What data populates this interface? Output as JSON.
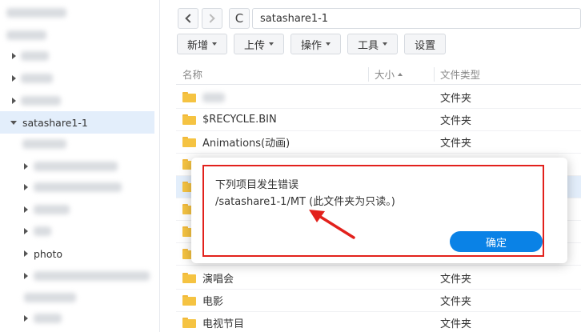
{
  "sidebar": {
    "selected_label": "satashare1-1",
    "child_label_photo": "photo"
  },
  "nav": {
    "refresh_glyph": "C",
    "path": "satashare1-1"
  },
  "toolbar": {
    "items": [
      {
        "label": "新增"
      },
      {
        "label": "上传"
      },
      {
        "label": "操作"
      },
      {
        "label": "工具"
      },
      {
        "label": "设置"
      }
    ]
  },
  "list": {
    "headers": {
      "name": "名称",
      "size": "大小",
      "type": "文件类型"
    },
    "rows": [
      {
        "name": "",
        "type": "文件夹"
      },
      {
        "name": "$RECYCLE.BIN",
        "type": "文件夹"
      },
      {
        "name": "Animations(动画)",
        "type": "文件夹"
      },
      {
        "name": "演唱会",
        "type": "文件夹"
      },
      {
        "name": "电影",
        "type": "文件夹"
      },
      {
        "name": "电视节目",
        "type": "文件夹"
      }
    ]
  },
  "dialog": {
    "title": "下列项目发生错误",
    "message": "/satashare1-1/MT (此文件夹为只读。)",
    "ok_label": "确定"
  },
  "colors": {
    "accent": "#0a82e6",
    "annotation": "#e2211c",
    "folder": "#f5c342",
    "selection": "#e3eefb"
  }
}
